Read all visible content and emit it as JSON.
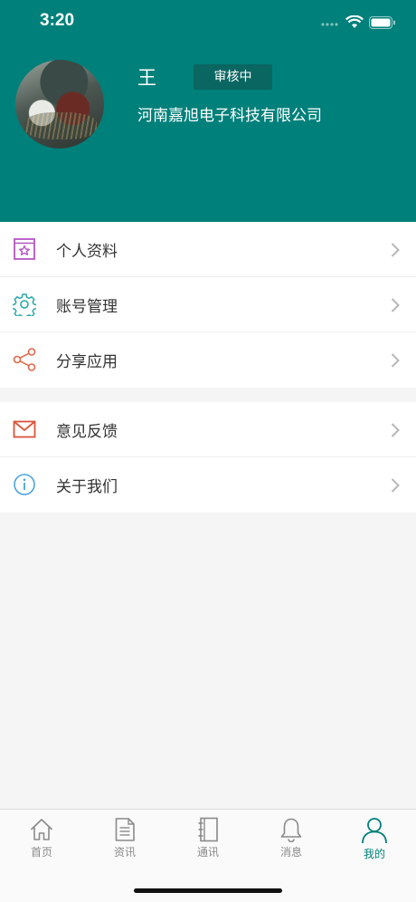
{
  "status_bar": {
    "time": "3:20"
  },
  "profile": {
    "name": "王",
    "status": "审核中",
    "company": "河南嘉旭电子科技有限公司"
  },
  "menu": {
    "group1": [
      {
        "label": "个人资料",
        "icon": "profile-card-icon"
      },
      {
        "label": "账号管理",
        "icon": "gear-icon"
      },
      {
        "label": "分享应用",
        "icon": "share-icon"
      }
    ],
    "group2": [
      {
        "label": "意见反馈",
        "icon": "mail-icon"
      },
      {
        "label": "关于我们",
        "icon": "info-icon"
      }
    ]
  },
  "tabbar": [
    {
      "label": "首页",
      "icon": "home-icon"
    },
    {
      "label": "资讯",
      "icon": "document-icon"
    },
    {
      "label": "通讯",
      "icon": "contacts-book-icon"
    },
    {
      "label": "消息",
      "icon": "bell-icon"
    },
    {
      "label": "我的",
      "icon": "person-icon",
      "active": true
    }
  ],
  "colors": {
    "primary": "#00807a",
    "badge": "#0a6661",
    "inactive": "#8a8a8a"
  }
}
